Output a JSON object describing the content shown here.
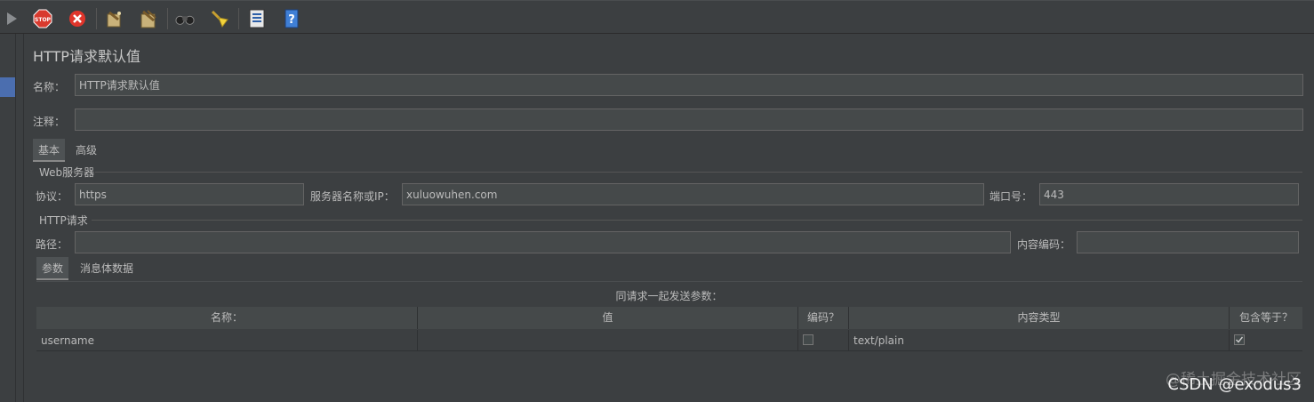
{
  "toolbar": {
    "icons": [
      "run-icon",
      "stop-icon",
      "shutdown-icon",
      "clear-icon",
      "clear-all-icon",
      "search-icon",
      "reset-search-icon",
      "function-helper-icon",
      "help-icon"
    ]
  },
  "panel": {
    "title": "HTTP请求默认值",
    "name_label": "名称：",
    "name_value": "HTTP请求默认值",
    "comment_label": "注释：",
    "comment_value": "",
    "tabs": [
      "基本",
      "高级"
    ],
    "web_server_group": "Web服务器",
    "protocol_label": "协议：",
    "protocol_value": "https",
    "server_label": "服务器名称或IP：",
    "server_value": "xuluowuhen.com",
    "port_label": "端口号：",
    "port_value": "443",
    "http_request_group": "HTTP请求",
    "path_label": "路径：",
    "path_value": "",
    "encoding_label": "内容编码：",
    "encoding_value": "",
    "sub_tabs": [
      "参数",
      "消息体数据"
    ],
    "params_caption": "同请求一起发送参数：",
    "table": {
      "columns": [
        "名称：",
        "值",
        "编码？",
        "内容类型",
        "包含等于？"
      ],
      "rows": [
        {
          "name": "username",
          "value": "",
          "encode": false,
          "content_type": "text/plain",
          "include_equals": true
        }
      ]
    }
  },
  "watermark": {
    "line1": "@稀土掘金技术社区",
    "line2": "CSDN @exodus3"
  },
  "colors": {
    "background": "#3c3f41",
    "field": "#45494a",
    "selection": "#4b6eaf"
  }
}
